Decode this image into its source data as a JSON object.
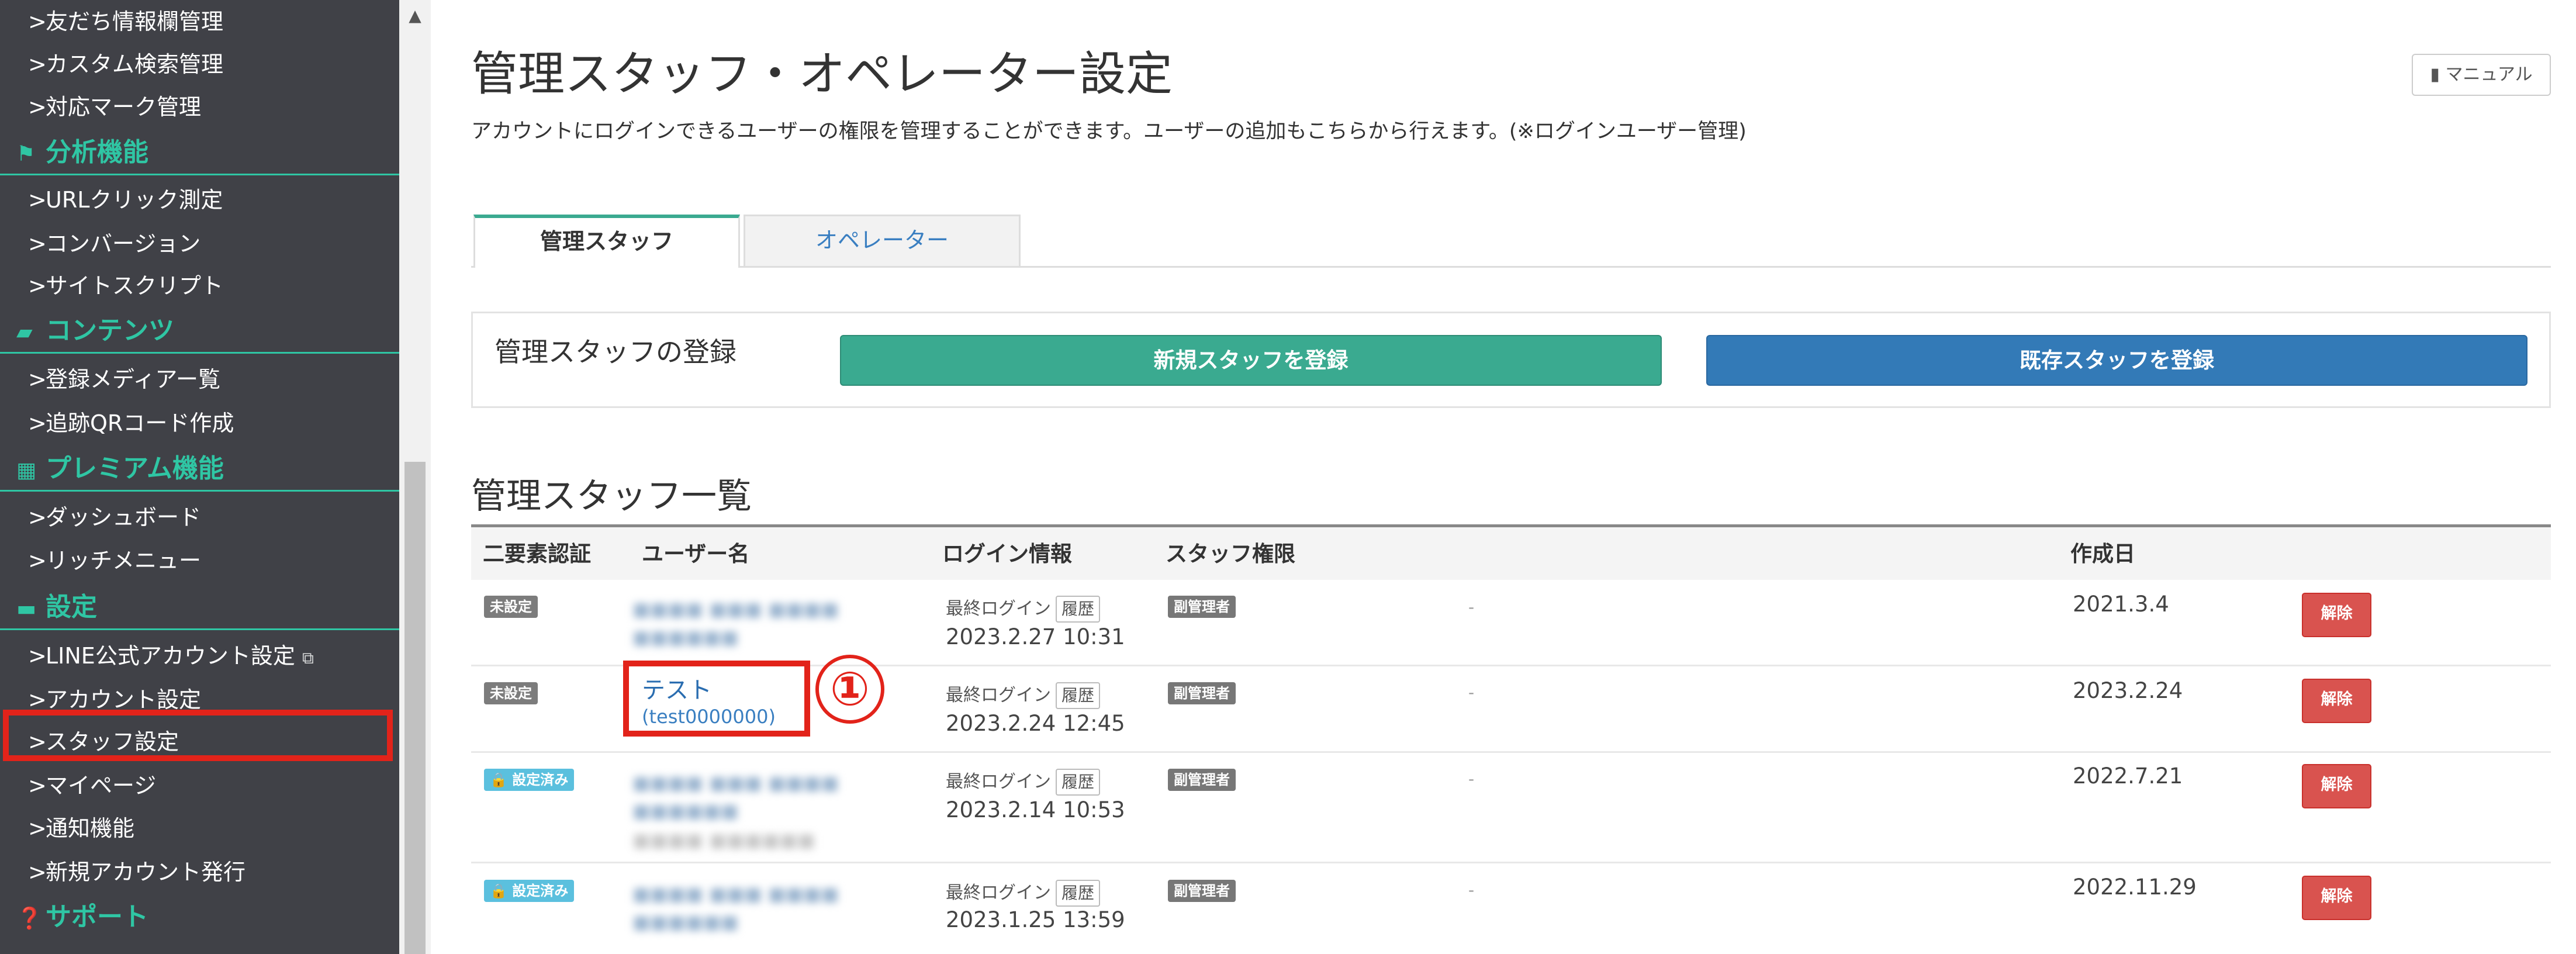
{
  "sidebar": {
    "items": [
      {
        "label": "友だち情報欄管理"
      },
      {
        "label": "カスタム検索管理"
      },
      {
        "label": "対応マーク管理"
      },
      {
        "label": "分析機能",
        "heading": true,
        "icon": "flag-icon"
      },
      {
        "label": "URLクリック測定"
      },
      {
        "label": "コンバージョン"
      },
      {
        "label": "サイトスクリプト"
      },
      {
        "label": "コンテンツ",
        "heading": true,
        "icon": "folder-icon"
      },
      {
        "label": "登録メディアー覧"
      },
      {
        "label": "追跡QRコード作成"
      },
      {
        "label": "プレミアム機能",
        "heading": true,
        "icon": "gift-icon"
      },
      {
        "label": "ダッシュボード"
      },
      {
        "label": "リッチメニュー"
      },
      {
        "label": "設定",
        "heading": true,
        "icon": "chat-icon"
      },
      {
        "label": "LINE公式アカウント設定",
        "external": true
      },
      {
        "label": "アカウント設定"
      },
      {
        "label": "スタッフ設定",
        "selected": true
      },
      {
        "label": "マイページ"
      },
      {
        "label": "通知機能"
      },
      {
        "label": "新規アカウント発行"
      },
      {
        "label": "サポート",
        "heading": true,
        "icon": "question-icon"
      }
    ],
    "arrow": ">",
    "external_icon": "⧉"
  },
  "header": {
    "title": "管理スタッフ・オペレーター設定",
    "description": "アカウントにログインできるユーザーの権限を管理することができます。ユーザーの追加もこちらから行えます。(※ログインユーザー管理)",
    "manual_button": "マニュアル"
  },
  "tabs": [
    {
      "label": "管理スタッフ",
      "active": true
    },
    {
      "label": "オペレーター",
      "active": false
    }
  ],
  "register": {
    "label": "管理スタッフの登録",
    "new_button": "新規スタッフを登録",
    "existing_button": "既存スタッフを登録"
  },
  "list": {
    "title": "管理スタッフ一覧",
    "columns": [
      "二要素認証",
      "ユーザー名",
      "ログイン情報",
      "スタッフ権限",
      "作成日"
    ],
    "login_label": "最終ログイン",
    "history_button": "履歴",
    "delete_button": "解除",
    "rows": [
      {
        "two_factor": "未設定",
        "two_factor_set": false,
        "user_name": "",
        "user_id": "",
        "last_login": "2023.2.27 10:31",
        "role": "副管理者",
        "note": "-",
        "created": "2021.3.4"
      },
      {
        "two_factor": "未設定",
        "two_factor_set": false,
        "user_name": "テスト",
        "user_id": "(test0000000)",
        "last_login": "2023.2.24 12:45",
        "role": "副管理者",
        "note": "-",
        "created": "2023.2.24"
      },
      {
        "two_factor": "設定済み",
        "two_factor_set": true,
        "user_name": "",
        "user_id": "",
        "last_login": "2023.2.14 10:53",
        "role": "副管理者",
        "note": "-",
        "created": "2022.7.21"
      },
      {
        "two_factor": "設定済み",
        "two_factor_set": true,
        "user_name": "",
        "user_id": "",
        "last_login": "2023.1.25 13:59",
        "role": "副管理者",
        "note": "-",
        "created": "2022.11.29"
      }
    ]
  },
  "annotation": {
    "step_number": "①"
  },
  "colors": {
    "sidebar_bg": "#404147",
    "accent_green": "#3aaa90",
    "primary_blue": "#337ab7",
    "danger_red": "#d9534f",
    "highlight_red": "#e2231a"
  }
}
